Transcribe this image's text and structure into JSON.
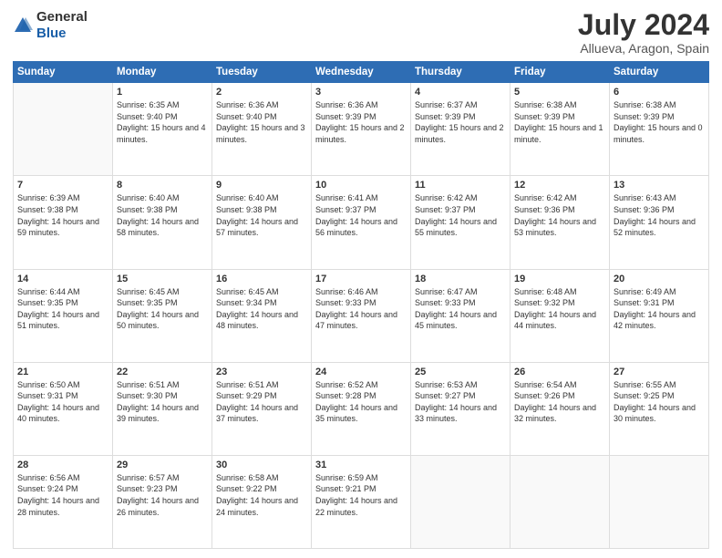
{
  "header": {
    "logo_line1": "General",
    "logo_line2": "Blue",
    "month_year": "July 2024",
    "location": "Allueva, Aragon, Spain"
  },
  "weekdays": [
    "Sunday",
    "Monday",
    "Tuesday",
    "Wednesday",
    "Thursday",
    "Friday",
    "Saturday"
  ],
  "weeks": [
    [
      {
        "day": "",
        "sunrise": "",
        "sunset": "",
        "daylight": ""
      },
      {
        "day": "1",
        "sunrise": "Sunrise: 6:35 AM",
        "sunset": "Sunset: 9:40 PM",
        "daylight": "Daylight: 15 hours and 4 minutes."
      },
      {
        "day": "2",
        "sunrise": "Sunrise: 6:36 AM",
        "sunset": "Sunset: 9:40 PM",
        "daylight": "Daylight: 15 hours and 3 minutes."
      },
      {
        "day": "3",
        "sunrise": "Sunrise: 6:36 AM",
        "sunset": "Sunset: 9:39 PM",
        "daylight": "Daylight: 15 hours and 2 minutes."
      },
      {
        "day": "4",
        "sunrise": "Sunrise: 6:37 AM",
        "sunset": "Sunset: 9:39 PM",
        "daylight": "Daylight: 15 hours and 2 minutes."
      },
      {
        "day": "5",
        "sunrise": "Sunrise: 6:38 AM",
        "sunset": "Sunset: 9:39 PM",
        "daylight": "Daylight: 15 hours and 1 minute."
      },
      {
        "day": "6",
        "sunrise": "Sunrise: 6:38 AM",
        "sunset": "Sunset: 9:39 PM",
        "daylight": "Daylight: 15 hours and 0 minutes."
      }
    ],
    [
      {
        "day": "7",
        "sunrise": "Sunrise: 6:39 AM",
        "sunset": "Sunset: 9:38 PM",
        "daylight": "Daylight: 14 hours and 59 minutes."
      },
      {
        "day": "8",
        "sunrise": "Sunrise: 6:40 AM",
        "sunset": "Sunset: 9:38 PM",
        "daylight": "Daylight: 14 hours and 58 minutes."
      },
      {
        "day": "9",
        "sunrise": "Sunrise: 6:40 AM",
        "sunset": "Sunset: 9:38 PM",
        "daylight": "Daylight: 14 hours and 57 minutes."
      },
      {
        "day": "10",
        "sunrise": "Sunrise: 6:41 AM",
        "sunset": "Sunset: 9:37 PM",
        "daylight": "Daylight: 14 hours and 56 minutes."
      },
      {
        "day": "11",
        "sunrise": "Sunrise: 6:42 AM",
        "sunset": "Sunset: 9:37 PM",
        "daylight": "Daylight: 14 hours and 55 minutes."
      },
      {
        "day": "12",
        "sunrise": "Sunrise: 6:42 AM",
        "sunset": "Sunset: 9:36 PM",
        "daylight": "Daylight: 14 hours and 53 minutes."
      },
      {
        "day": "13",
        "sunrise": "Sunrise: 6:43 AM",
        "sunset": "Sunset: 9:36 PM",
        "daylight": "Daylight: 14 hours and 52 minutes."
      }
    ],
    [
      {
        "day": "14",
        "sunrise": "Sunrise: 6:44 AM",
        "sunset": "Sunset: 9:35 PM",
        "daylight": "Daylight: 14 hours and 51 minutes."
      },
      {
        "day": "15",
        "sunrise": "Sunrise: 6:45 AM",
        "sunset": "Sunset: 9:35 PM",
        "daylight": "Daylight: 14 hours and 50 minutes."
      },
      {
        "day": "16",
        "sunrise": "Sunrise: 6:45 AM",
        "sunset": "Sunset: 9:34 PM",
        "daylight": "Daylight: 14 hours and 48 minutes."
      },
      {
        "day": "17",
        "sunrise": "Sunrise: 6:46 AM",
        "sunset": "Sunset: 9:33 PM",
        "daylight": "Daylight: 14 hours and 47 minutes."
      },
      {
        "day": "18",
        "sunrise": "Sunrise: 6:47 AM",
        "sunset": "Sunset: 9:33 PM",
        "daylight": "Daylight: 14 hours and 45 minutes."
      },
      {
        "day": "19",
        "sunrise": "Sunrise: 6:48 AM",
        "sunset": "Sunset: 9:32 PM",
        "daylight": "Daylight: 14 hours and 44 minutes."
      },
      {
        "day": "20",
        "sunrise": "Sunrise: 6:49 AM",
        "sunset": "Sunset: 9:31 PM",
        "daylight": "Daylight: 14 hours and 42 minutes."
      }
    ],
    [
      {
        "day": "21",
        "sunrise": "Sunrise: 6:50 AM",
        "sunset": "Sunset: 9:31 PM",
        "daylight": "Daylight: 14 hours and 40 minutes."
      },
      {
        "day": "22",
        "sunrise": "Sunrise: 6:51 AM",
        "sunset": "Sunset: 9:30 PM",
        "daylight": "Daylight: 14 hours and 39 minutes."
      },
      {
        "day": "23",
        "sunrise": "Sunrise: 6:51 AM",
        "sunset": "Sunset: 9:29 PM",
        "daylight": "Daylight: 14 hours and 37 minutes."
      },
      {
        "day": "24",
        "sunrise": "Sunrise: 6:52 AM",
        "sunset": "Sunset: 9:28 PM",
        "daylight": "Daylight: 14 hours and 35 minutes."
      },
      {
        "day": "25",
        "sunrise": "Sunrise: 6:53 AM",
        "sunset": "Sunset: 9:27 PM",
        "daylight": "Daylight: 14 hours and 33 minutes."
      },
      {
        "day": "26",
        "sunrise": "Sunrise: 6:54 AM",
        "sunset": "Sunset: 9:26 PM",
        "daylight": "Daylight: 14 hours and 32 minutes."
      },
      {
        "day": "27",
        "sunrise": "Sunrise: 6:55 AM",
        "sunset": "Sunset: 9:25 PM",
        "daylight": "Daylight: 14 hours and 30 minutes."
      }
    ],
    [
      {
        "day": "28",
        "sunrise": "Sunrise: 6:56 AM",
        "sunset": "Sunset: 9:24 PM",
        "daylight": "Daylight: 14 hours and 28 minutes."
      },
      {
        "day": "29",
        "sunrise": "Sunrise: 6:57 AM",
        "sunset": "Sunset: 9:23 PM",
        "daylight": "Daylight: 14 hours and 26 minutes."
      },
      {
        "day": "30",
        "sunrise": "Sunrise: 6:58 AM",
        "sunset": "Sunset: 9:22 PM",
        "daylight": "Daylight: 14 hours and 24 minutes."
      },
      {
        "day": "31",
        "sunrise": "Sunrise: 6:59 AM",
        "sunset": "Sunset: 9:21 PM",
        "daylight": "Daylight: 14 hours and 22 minutes."
      },
      {
        "day": "",
        "sunrise": "",
        "sunset": "",
        "daylight": ""
      },
      {
        "day": "",
        "sunrise": "",
        "sunset": "",
        "daylight": ""
      },
      {
        "day": "",
        "sunrise": "",
        "sunset": "",
        "daylight": ""
      }
    ]
  ]
}
